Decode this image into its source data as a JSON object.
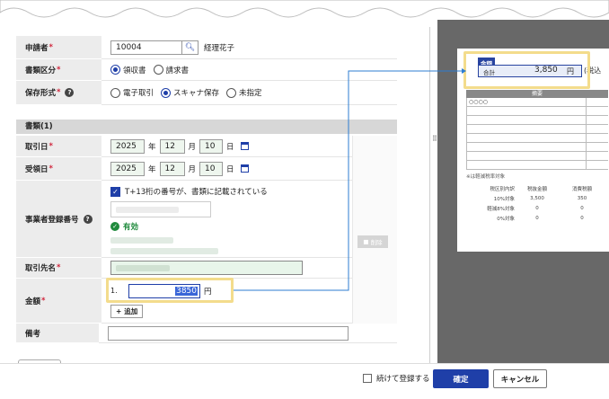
{
  "form": {
    "applicant": {
      "label": "申請者",
      "code": "10004",
      "name": "経理花子"
    },
    "doc_type": {
      "label": "書類区分",
      "options": [
        "領収書",
        "請求書"
      ],
      "selected": "領収書"
    },
    "storage": {
      "label": "保存形式",
      "options": [
        "電子取引",
        "スキャナ保存",
        "未指定"
      ],
      "selected": "スキャナ保存"
    },
    "section_title": "書類(1)",
    "tx_date": {
      "label": "取引日",
      "year": "2025",
      "month": "12",
      "day": "10",
      "y": "年",
      "m": "月",
      "d": "日"
    },
    "recv_date": {
      "label": "受領日",
      "year": "2025",
      "month": "12",
      "day": "10",
      "y": "年",
      "m": "月",
      "d": "日"
    },
    "registration": {
      "label": "事業者登録番号",
      "check_label": "T+13桁の番号が、書類に記載されている",
      "status": "有効"
    },
    "partner": {
      "label": "取引先名"
    },
    "amount": {
      "label": "金額",
      "index": "1.",
      "value": "3850",
      "unit": "円",
      "add_label": "追加"
    },
    "note": {
      "label": "備考"
    },
    "delete_label": "削除"
  },
  "preview": {
    "box_title": "金額",
    "total_label": "合計",
    "total_value": "3,850",
    "total_unit": "円",
    "total_suffix": "(税込",
    "table_header": "摘要",
    "first_item": "○○○○",
    "note": "※は軽減税率対象",
    "tax_headers": [
      "税区別内訳",
      "税抜金額",
      "消費税額"
    ],
    "tax_rows": [
      [
        "10%対象",
        "3,500",
        "350"
      ],
      [
        "軽減8%対象",
        "0",
        "0"
      ],
      [
        "0%対象",
        "0",
        "0"
      ]
    ]
  },
  "footer": {
    "continue_label": "続けて登録する",
    "confirm_label": "確定",
    "cancel_label": "キャンセル"
  },
  "colors": {
    "accent": "#1f3fa8",
    "highlight": "#f3dc8c",
    "required": "#d0243b"
  }
}
